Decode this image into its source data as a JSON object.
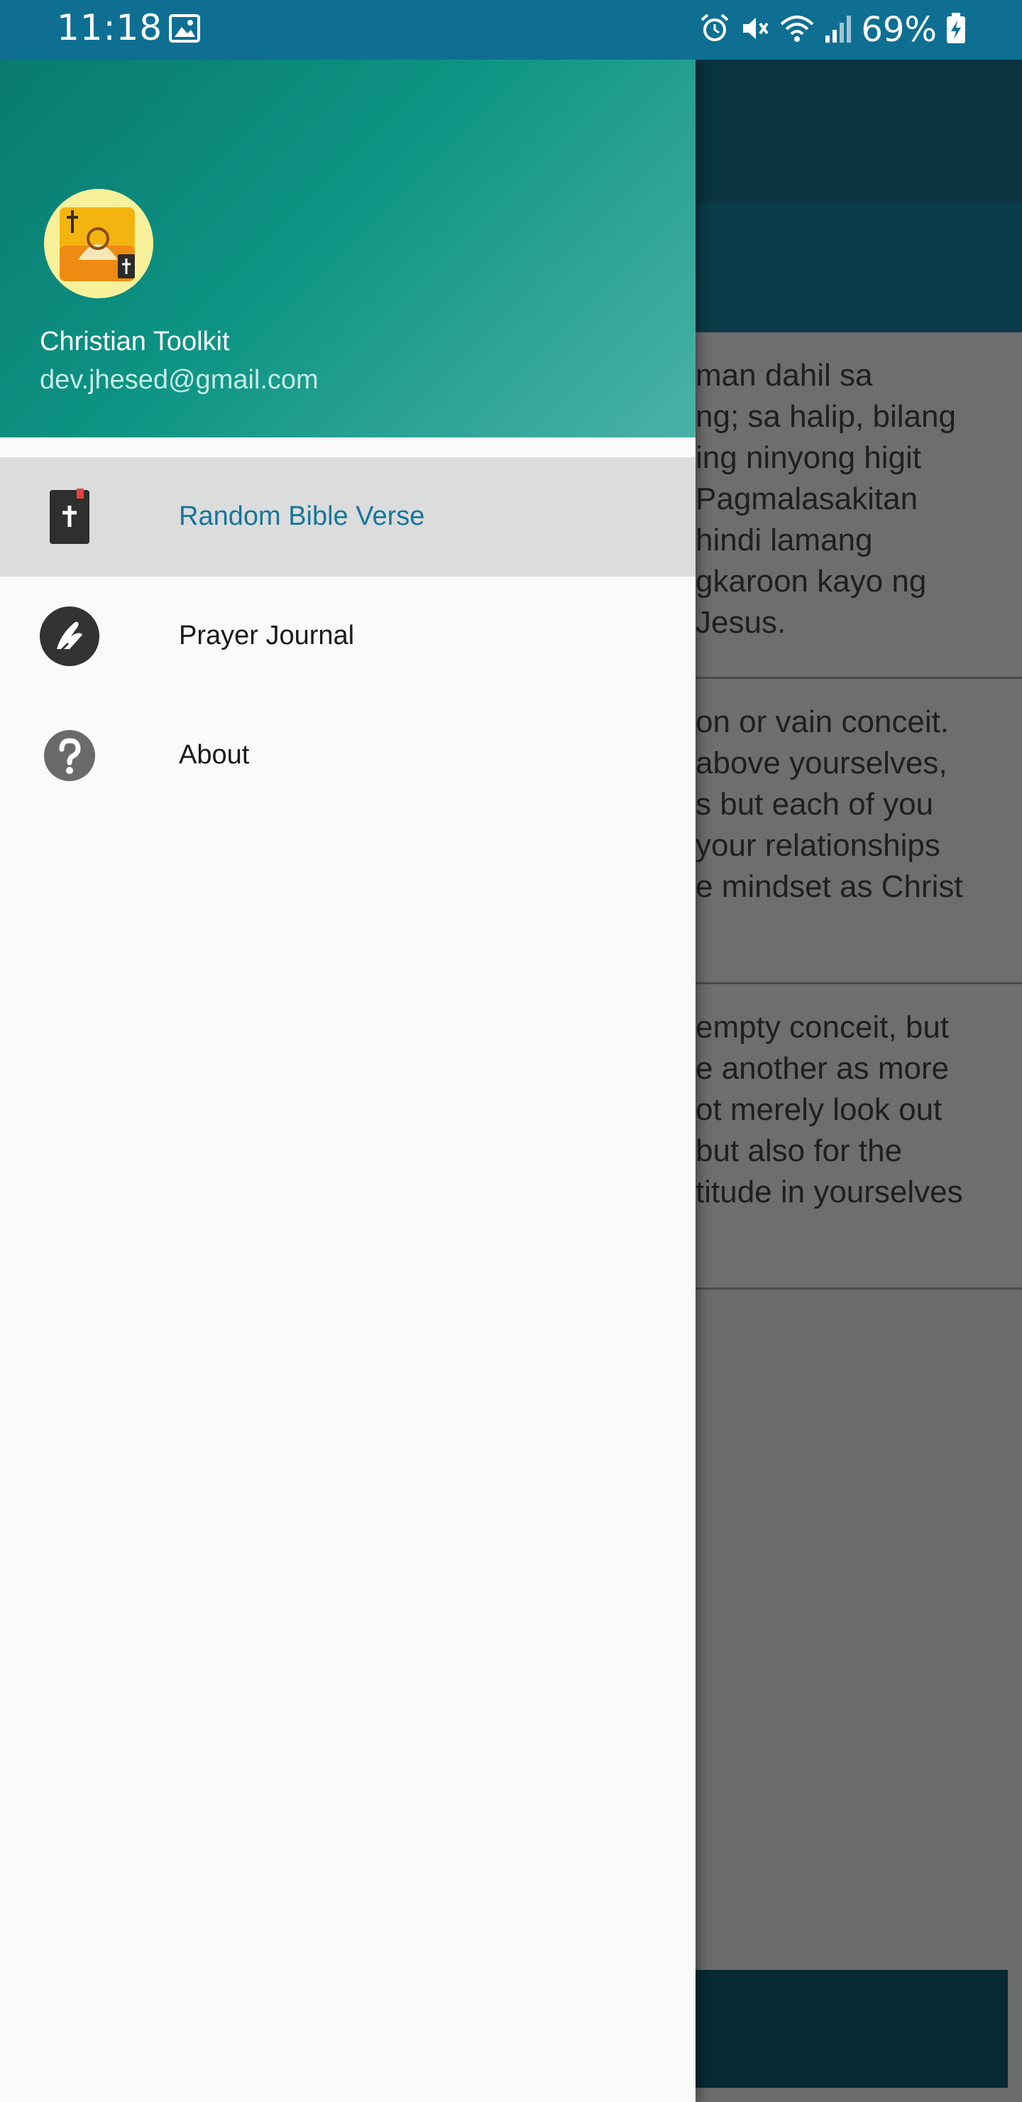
{
  "status_bar": {
    "time": "11:18",
    "battery": "69%",
    "icons": [
      "image-icon",
      "alarm-icon",
      "mute-icon",
      "wifi-icon",
      "signal-icon",
      "battery-charging-icon"
    ]
  },
  "drawer": {
    "header": {
      "app_name": "Christian Toolkit",
      "email": "dev.jhesed@gmail.com"
    },
    "items": [
      {
        "label": "Random Bible Verse",
        "icon": "bible-icon",
        "active": true
      },
      {
        "label": "Prayer Journal",
        "icon": "praying-hands-icon",
        "active": false
      },
      {
        "label": "About",
        "icon": "help-icon",
        "active": false
      }
    ]
  },
  "background": {
    "verses": [
      "man dahil sa\nng; sa halip, bilang\ning ninyong higit\n Pagmalasakitan\nhindi lamang\ngkaroon kayo ng\nJesus.",
      "on or vain conceit.\nabove yourselves,\ns but each of you\nyour relationships\ne mindset as Christ",
      "empty conceit, but\ne another as more\not merely look out\n but also for the\ntitude in yourselves"
    ]
  },
  "colors": {
    "status_bar": "#0e6f93",
    "active_label": "#17769c",
    "header_gradient_start": "#0a7a70",
    "header_gradient_end": "#4ab2a6"
  }
}
